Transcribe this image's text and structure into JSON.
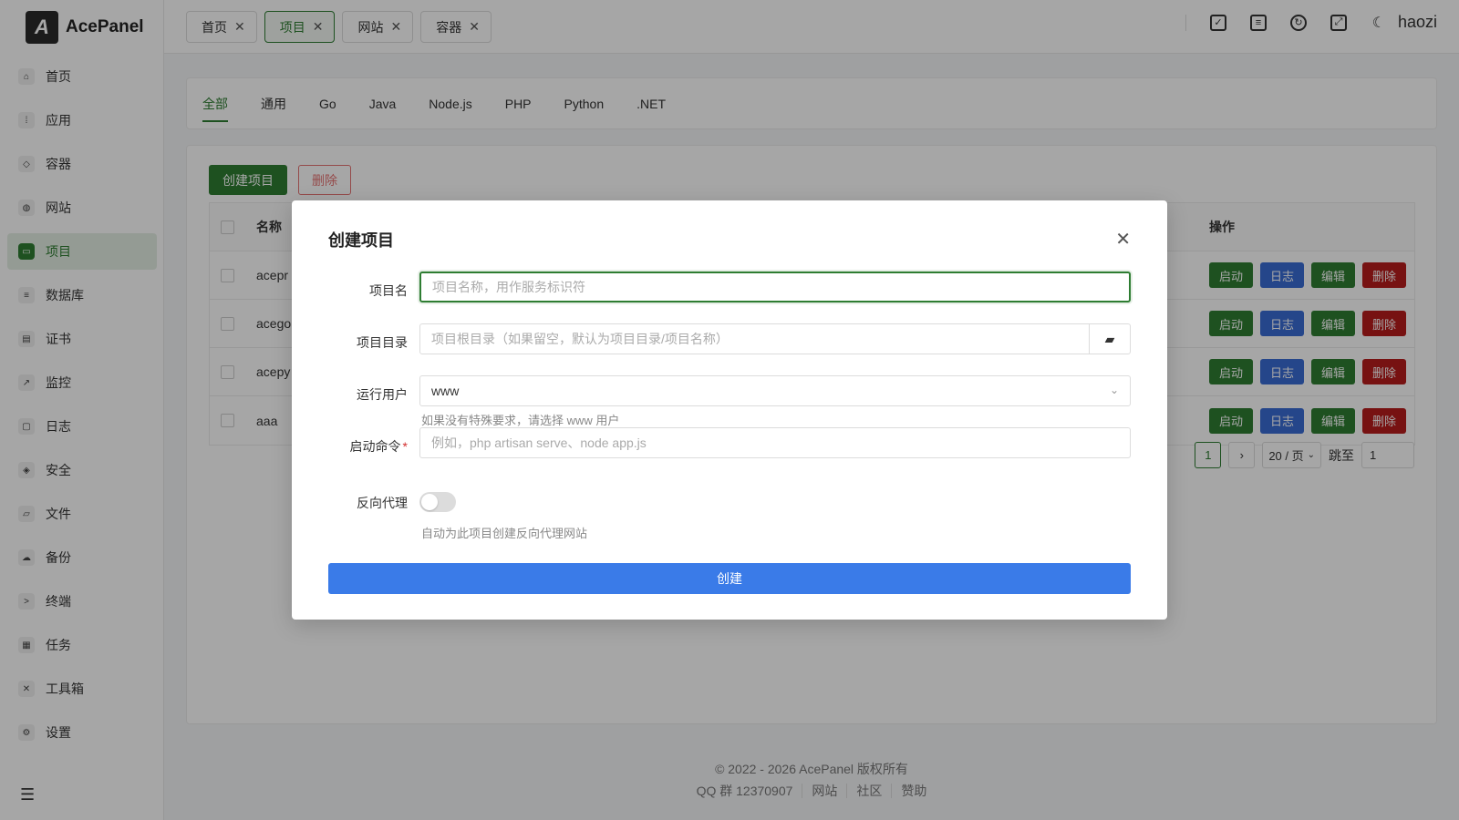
{
  "app": {
    "logo_letter": "A",
    "logo_text": "AcePanel",
    "username": "haozi"
  },
  "sidebar": {
    "items": [
      {
        "label": "首页",
        "icon": "home-icon",
        "glyph": "⌂"
      },
      {
        "label": "应用",
        "icon": "apps-icon",
        "glyph": "⁞"
      },
      {
        "label": "容器",
        "icon": "container-icon",
        "glyph": "◇"
      },
      {
        "label": "网站",
        "icon": "globe-icon",
        "glyph": "◍"
      },
      {
        "label": "项目",
        "icon": "project-icon",
        "glyph": "▭",
        "active": true
      },
      {
        "label": "数据库",
        "icon": "database-icon",
        "glyph": "≡"
      },
      {
        "label": "证书",
        "icon": "certificate-icon",
        "glyph": "▤"
      },
      {
        "label": "监控",
        "icon": "monitor-icon",
        "glyph": "↗"
      },
      {
        "label": "日志",
        "icon": "log-icon",
        "glyph": "▢"
      },
      {
        "label": "安全",
        "icon": "shield-icon",
        "glyph": "◈"
      },
      {
        "label": "文件",
        "icon": "folder-icon",
        "glyph": "▱"
      },
      {
        "label": "备份",
        "icon": "cloud-icon",
        "glyph": "☁"
      },
      {
        "label": "终端",
        "icon": "terminal-icon",
        "glyph": ">"
      },
      {
        "label": "任务",
        "icon": "task-icon",
        "glyph": "▦"
      },
      {
        "label": "工具箱",
        "icon": "tools-icon",
        "glyph": "✕"
      },
      {
        "label": "设置",
        "icon": "gear-icon",
        "glyph": "⚙"
      }
    ],
    "collapse_glyph": "☰"
  },
  "header": {
    "tabs": [
      {
        "label": "首页"
      },
      {
        "label": "项目",
        "active": true
      },
      {
        "label": "网站"
      },
      {
        "label": "容器"
      }
    ],
    "close_glyph": "✕"
  },
  "lang_tabs": [
    "全部",
    "通用",
    "Go",
    "Java",
    "Node.js",
    "PHP",
    "Python",
    ".NET"
  ],
  "toolbar": {
    "create_label": "创建项目",
    "delete_label": "删除"
  },
  "table": {
    "headers": {
      "name": "名称",
      "ops": "操作"
    },
    "rows": [
      {
        "name": "acepr"
      },
      {
        "name": "acego"
      },
      {
        "name": "acepy"
      },
      {
        "name": "aaa"
      }
    ],
    "ops": {
      "start": "启动",
      "log": "日志",
      "edit": "编辑",
      "delete": "删除"
    }
  },
  "pager": {
    "current": "1",
    "next": "›",
    "page_size": "20 / 页",
    "jump_label": "跳至",
    "jump_value": "1"
  },
  "footer": {
    "copyright": "© 2022 - 2026 AcePanel 版权所有",
    "links": [
      "QQ 群 12370907",
      "网站",
      "社区",
      "赞助"
    ]
  },
  "modal": {
    "title": "创建项目",
    "name_label": "项目名",
    "name_placeholder": "项目名称，用作服务标识符",
    "dir_label": "项目目录",
    "dir_placeholder": "项目根目录（如果留空，默认为项目目录/项目名称）",
    "user_label": "运行用户",
    "user_value": "www",
    "user_hint": "如果没有特殊要求，请选择 www 用户",
    "cmd_label": "启动命令",
    "cmd_required": "*",
    "cmd_placeholder": "例如，php artisan serve、node app.js",
    "proxy_label": "反向代理",
    "proxy_hint": "自动为此项目创建反向代理网站",
    "submit_label": "创建"
  },
  "colors": {
    "primary": "#2e7d32",
    "blue": "#3a6cd4",
    "red": "#b71c1c",
    "submit": "#3a7be8"
  }
}
